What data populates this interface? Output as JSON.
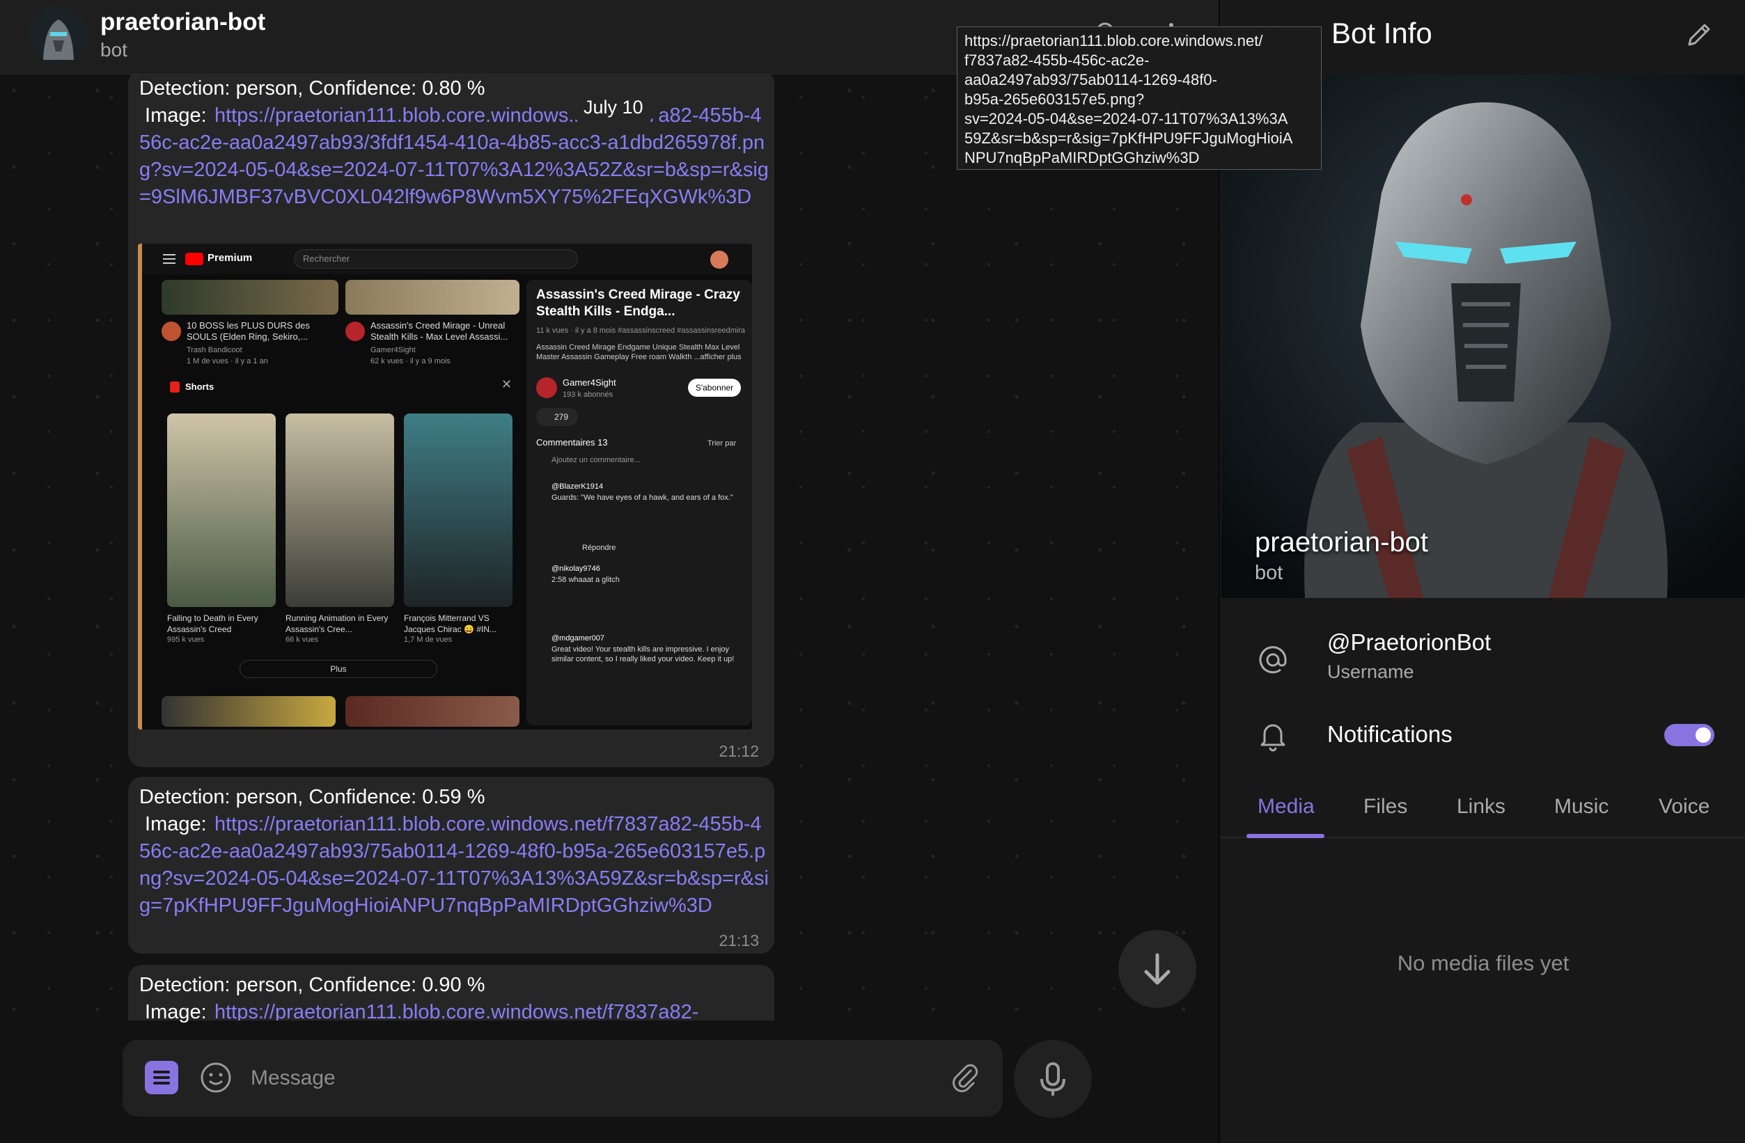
{
  "chat": {
    "title": "praetorian-bot",
    "subtitle": "bot",
    "date_label": "July 10",
    "messages": [
      {
        "text": "Detection: person, Confidence: 0.80 %",
        "image_prefix": " Image: ",
        "link": "https://praetorian111.blob.core.windows.net/f7837a82-455b-456c-ac2e-aa0a2497ab93/3fdf1454-410a-4b85-acc3-a1dbd265978f.png?sv=2024-05-04&se=2024-07-11T07%3A12%3A52Z&sr=b&sp=r&sig=9SlM6JMBF37vBVC0XL042lf9w6P8Wvm5XY75%2FEqXGWk%3D",
        "time": "21:12"
      },
      {
        "text": "Detection: person, Confidence: 0.59 %",
        "image_prefix": " Image: ",
        "link": "https://praetorian111.blob.core.windows.net/f7837a82-455b-456c-ac2e-aa0a2497ab93/75ab0114-1269-48f0-b95a-265e603157e5.png?sv=2024-05-04&se=2024-07-11T07%3A13%3A59Z&sr=b&sp=r&sig=7pKfHPU9FFJguMogHioiANPU7nqBpPaMIRDptGGhziw%3D",
        "time": "21:13"
      },
      {
        "text": "Detection: person, Confidence: 0.90 %",
        "image_prefix": " Image: ",
        "link": "https://praetorian111.blob.core.windows.net/f7837a82-"
      }
    ],
    "composer_placeholder": "Message"
  },
  "embedded_screenshot": {
    "brand": "Premium",
    "search_placeholder": "Rechercher",
    "video1_title": "10 BOSS les PLUS DURS des SOULS (Elden Ring, Sekiro,...",
    "video1_channel": "Trash Bandicoot",
    "video1_meta": "1 M de vues · il y a 1 an",
    "video2_title": "Assassin's Creed Mirage - Unreal Stealth Kills - Max Level Assassi...",
    "video2_channel": "Gamer4Sight",
    "video2_meta": "62 k vues · il y a 9 mois",
    "shorts_label": "Shorts",
    "short1_title": "Falling to Death in Every Assassin's Creed",
    "short1_views": "995 k vues",
    "short2_title": "Running Animation in Every Assassin's Cree...",
    "short2_views": "66 k vues",
    "short3_title": "François Mitterrand VS Jacques Chirac 😄 #IN...",
    "short3_views": "1,7 M de vues",
    "more_label": "Plus",
    "side_title": "Assassin's Creed Mirage - Crazy Stealth Kills - Endga...",
    "side_meta": "11 k vues · il y a 8 mois #assassinscreed #assassinsreedmira",
    "side_desc": "Assassin Creed Mirage Endgame Unique Stealth Max Level Master Assassin Gameplay Free roam Walkth ...afficher plus",
    "side_channel": "Gamer4Sight",
    "side_subs": "193 k abonnés",
    "subscribe_label": "S'abonner",
    "likes": "279",
    "comments_label": "Commentaires 13",
    "sort_label": "Trier par",
    "add_comment": "Ajoutez un commentaire...",
    "c1_user": "@BlazerK1914",
    "c1_text": "Guards: \"We have eyes of a hawk, and ears of a fox.\"",
    "c2_user": "@nikolay9746",
    "c2_text": "2:58 whaaat a glitch",
    "c3_user": "@mdgamer007",
    "c3_text": "Great video! Your stealth kills are impressive. I enjoy similar content, so I really liked your video. Keep it up!",
    "reply_label": "Répondre"
  },
  "tooltip": {
    "lines": [
      "https://praetorian111.blob.core.windows.net/",
      "f7837a82-455b-456c-ac2e-",
      "aa0a2497ab93/75ab0114-1269-48f0-",
      "b95a-265e603157e5.png?",
      "sv=2024-05-04&se=2024-07-11T07%3A13%3A",
      "59Z&sr=b&sp=r&sig=7pKfHPU9FFJguMogHioiA",
      "NPU7nqBpPaMIRDptGGhziw%3D"
    ]
  },
  "bot_info": {
    "title": "Bot Info",
    "name": "praetorian-bot",
    "subtitle": "bot",
    "username": "@PraetorionBot",
    "username_label": "Username",
    "notifications_label": "Notifications",
    "notifications_on": true,
    "tabs": [
      "Media",
      "Files",
      "Links",
      "Music",
      "Voice"
    ],
    "active_tab": "Media",
    "empty_text": "No media files yet"
  },
  "colors": {
    "accent": "#8774e1",
    "link": "#8b7cf6",
    "bubble": "#262626"
  }
}
